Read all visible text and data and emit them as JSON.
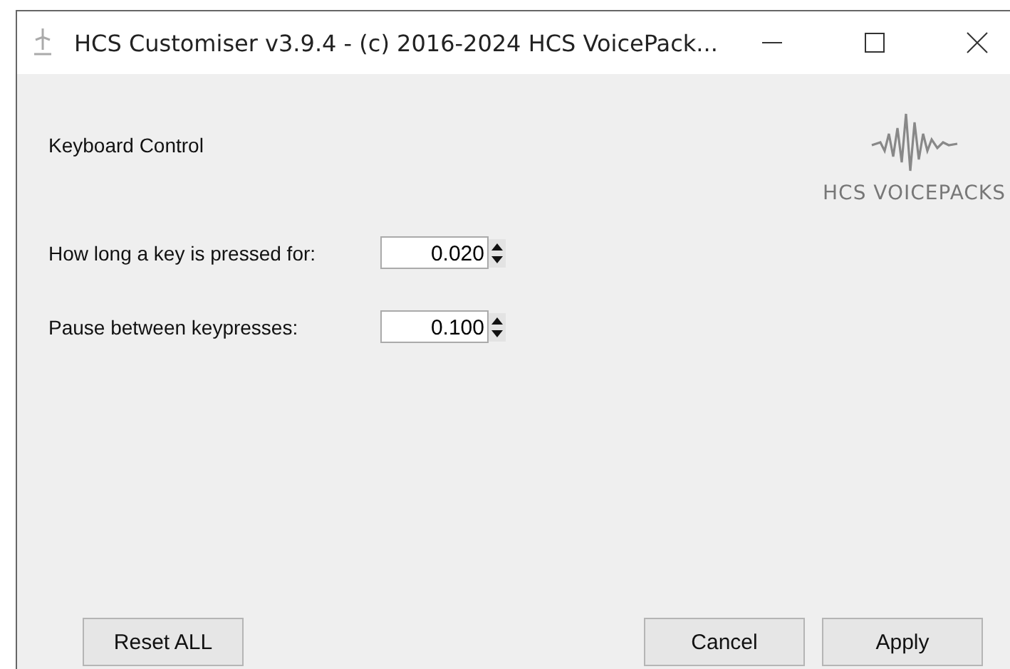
{
  "window": {
    "title": "HCS Customiser v3.9.4 - (c) 2016-2024 HCS VoicePack..."
  },
  "heading": "Keyboard Control",
  "logo": {
    "text": "HCS VOICEPACKS"
  },
  "fields": [
    {
      "label": "How long a key is pressed for:",
      "value": "0.020"
    },
    {
      "label": "Pause between keypresses:",
      "value": "0.100"
    }
  ],
  "buttons": {
    "left": [
      "Reset ALL"
    ],
    "right": [
      "Cancel",
      "Apply"
    ]
  }
}
